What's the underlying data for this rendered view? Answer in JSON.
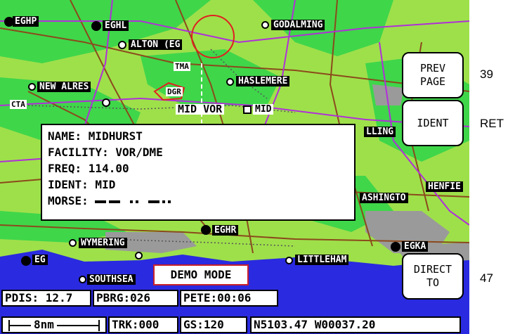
{
  "map_labels": {
    "eghp": "EGHP",
    "eghl": "EGHL",
    "godalming": "GODALMING",
    "alton": "ALTON (EG",
    "tma": "TMA",
    "new_alres": "NEW ALRES",
    "haslemere": "HASLEMERE",
    "dgr": "DGR",
    "cta": "CTA",
    "midvor": "MID VOR",
    "mid": "MID",
    "lling": "LLING",
    "henfie": "HENFIE",
    "ashingto": "ASHINGTO",
    "eghr": "EGHR",
    "wymering": "WYMERING",
    "eg": "EG",
    "southsea": "SOUTHSEA",
    "littleham": "LITTLEHAM",
    "egka": "EGKA"
  },
  "info_box": {
    "name": "NAME: MIDHURST",
    "facility": "FACILITY: VOR/DME",
    "freq": "FREQ: 114.00",
    "ident": "IDENT: MID",
    "morse_label": "MORSE:"
  },
  "softkeys": {
    "prev_page": [
      "PREV",
      "PAGE"
    ],
    "ident": "IDENT",
    "direct_to": [
      "DIRECT",
      "TO"
    ]
  },
  "key_numbers": {
    "prev_page": "39",
    "ident": "RET",
    "direct_to": "47"
  },
  "demo_mode": "DEMO MODE",
  "status": {
    "pdis": "PDIS: 12.7",
    "pbrg": "PBRG:026",
    "pete": "PETE:00:06",
    "scale": "8nm",
    "trk": "TRK:000",
    "gs": "GS:120",
    "position": "N5103.47 W00037.20"
  },
  "colors": {
    "land": "#9ee04a",
    "forest": "#3fd64a",
    "sea": "#2a2ae0",
    "urban": "#9a9a9a",
    "road": "#8b4a1c",
    "airspace": "#b030d8",
    "range_ring": "#e02020"
  }
}
